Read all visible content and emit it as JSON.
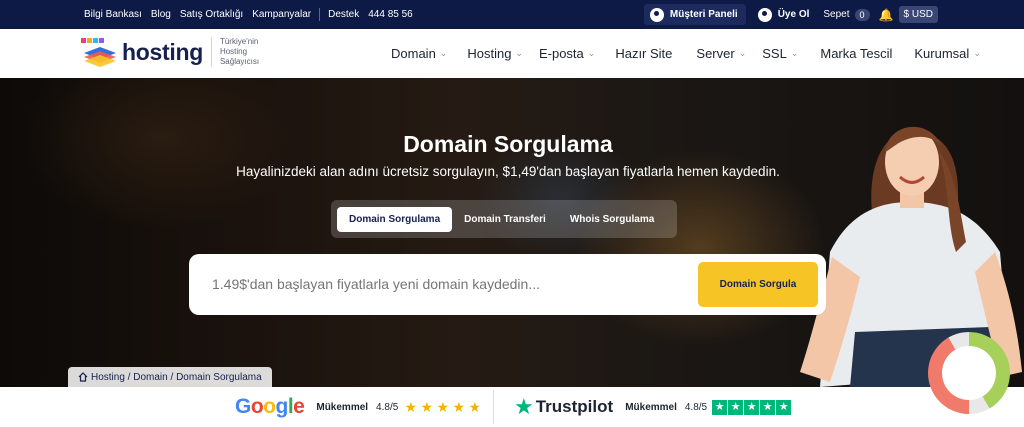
{
  "topbar": {
    "links": [
      "Bilgi Bankası",
      "Blog",
      "Satış Ortaklığı",
      "Kampanyalar"
    ],
    "support_label": "Destek",
    "support_phone": "444 85 56",
    "customer_panel": "Müşteri Paneli",
    "register": "Üye Ol",
    "cart_label": "Sepet",
    "cart_count": "0",
    "currency": "$ USD"
  },
  "header": {
    "logo_text": "hosting",
    "tagline": [
      "Türkiye'nin",
      "Hosting",
      "Sağlayıcısı"
    ],
    "nav": [
      {
        "label": "Domain",
        "dropdown": true
      },
      {
        "label": "Hosting",
        "dropdown": true
      },
      {
        "label": "E-posta",
        "dropdown": true
      },
      {
        "label": "Hazır Site",
        "dropdown": false
      },
      {
        "label": "Server",
        "dropdown": true
      },
      {
        "label": "SSL",
        "dropdown": true
      },
      {
        "label": "Marka Tescil",
        "dropdown": false
      },
      {
        "label": "Kurumsal",
        "dropdown": true
      }
    ]
  },
  "hero": {
    "title": "Domain Sorgulama",
    "subtitle": "Hayalinizdeki alan adını ücretsiz sorgulayın, $1,49'dan başlayan fiyatlarla hemen kaydedin.",
    "tabs": [
      "Domain Sorgulama",
      "Domain Transferi",
      "Whois Sorgulama"
    ],
    "active_tab": 0,
    "search_placeholder": "1.49$'dan başlayan fiyatlarla yeni domain kaydedin...",
    "search_button": "Domain Sorgula",
    "breadcrumb": [
      "Hosting",
      "Domain",
      "Domain Sorgulama"
    ]
  },
  "ratings": {
    "google": {
      "brand": "Google",
      "label": "Mükemmel",
      "score": "4.8/5",
      "stars": 4.8
    },
    "trustpilot": {
      "brand": "Trustpilot",
      "label": "Mükemmel",
      "score": "4.8/5",
      "stars": 5
    }
  },
  "colors": {
    "topbar_bg": "#0d1a45",
    "accent_yellow": "#f6c525",
    "trustpilot_green": "#00b67a",
    "brand_navy": "#16214f"
  }
}
